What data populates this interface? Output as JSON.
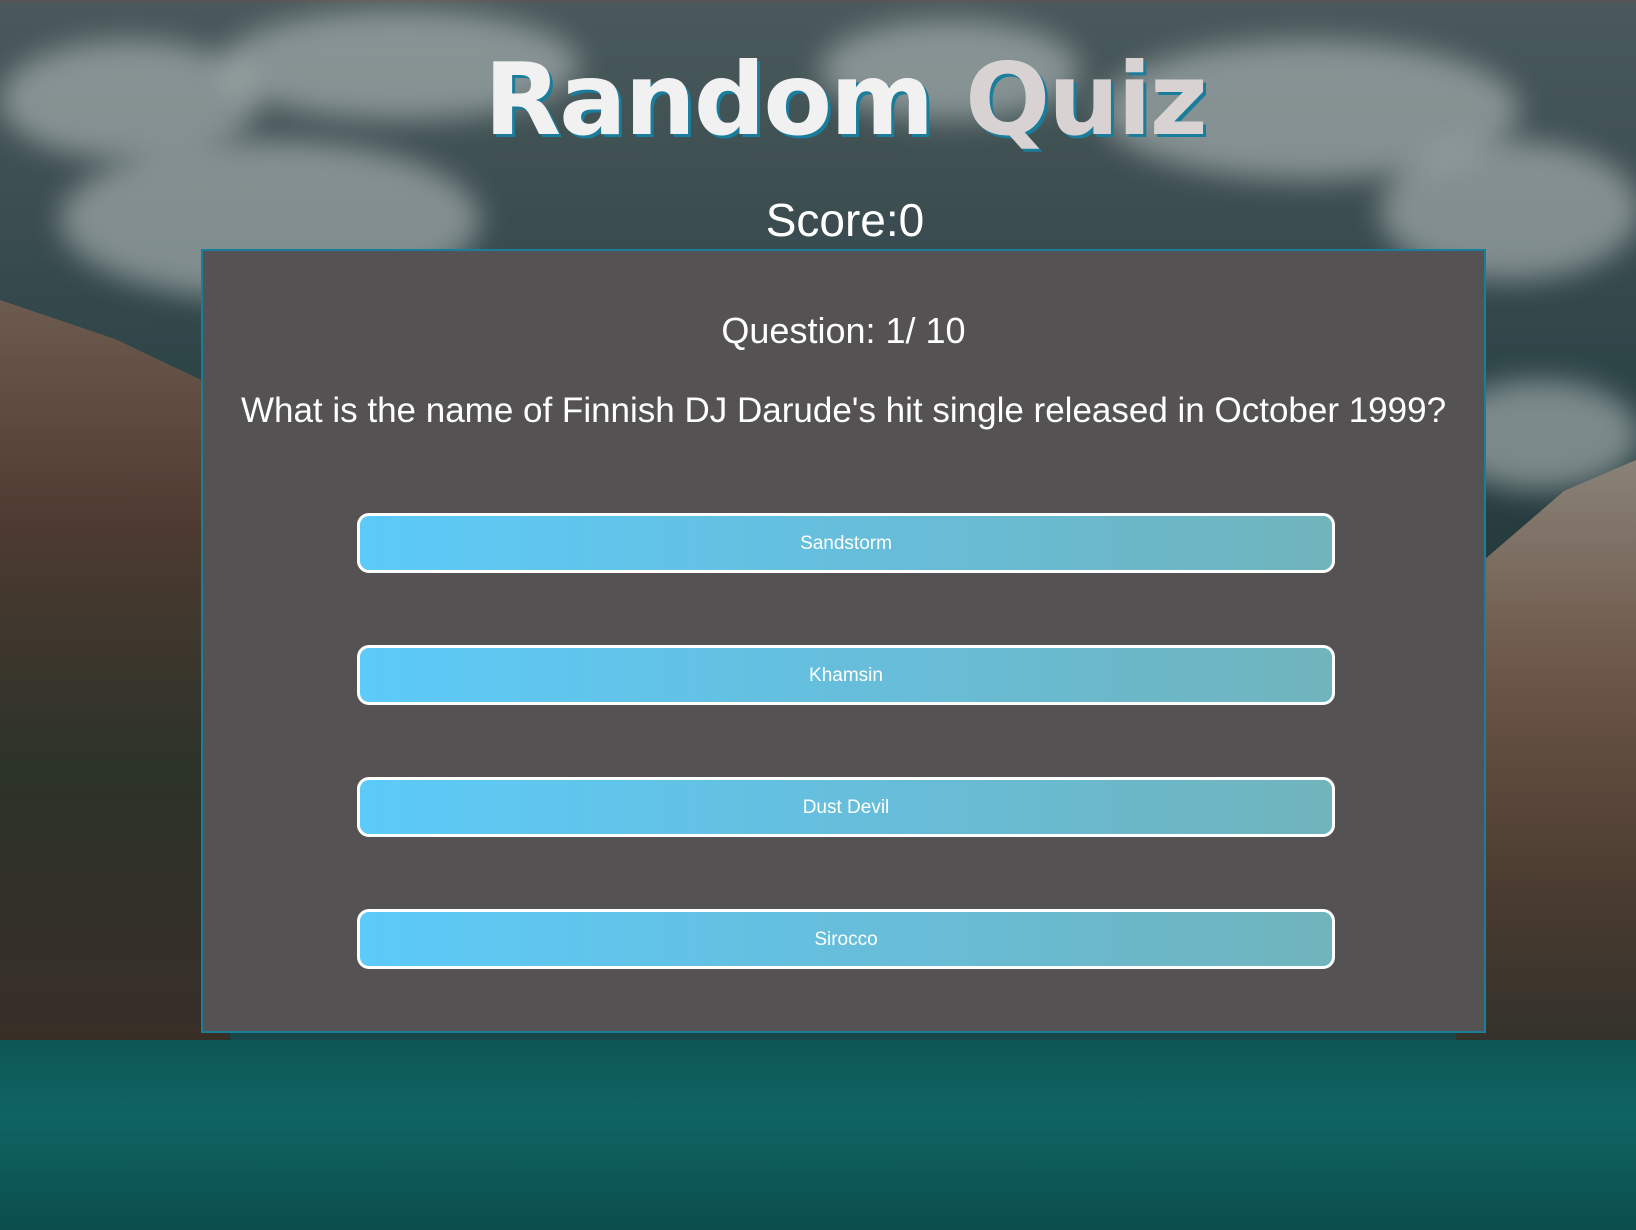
{
  "header": {
    "title_word1": "Random",
    "title_word2": "Quiz",
    "score_label": "Score:",
    "score_value": "0"
  },
  "question": {
    "counter_label": "Question: 1/ 10",
    "text": "What is the name of Finnish DJ Darude's hit single released in October 1999?"
  },
  "answers": [
    {
      "label": "Sandstorm"
    },
    {
      "label": "Khamsin"
    },
    {
      "label": "Dust Devil"
    },
    {
      "label": "Sirocco"
    }
  ],
  "colors": {
    "accent": "#1a7d9c",
    "card_background": "#545252",
    "button_gradient_start": "#5ccbf9",
    "button_gradient_end": "#70b4bc"
  }
}
